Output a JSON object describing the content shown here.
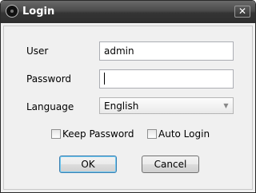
{
  "window": {
    "title": "Login",
    "close_glyph": "✕",
    "app_icon": "app-icon"
  },
  "form": {
    "user_label": "User",
    "user_value": "admin",
    "password_label": "Password",
    "password_value": "",
    "language_label": "Language",
    "language_value": "English",
    "language_arrow": "▼"
  },
  "options": {
    "keep_password_label": "Keep Password",
    "keep_password_checked": false,
    "auto_login_label": "Auto Login",
    "auto_login_checked": false
  },
  "buttons": {
    "ok_label": "OK",
    "cancel_label": "Cancel"
  }
}
